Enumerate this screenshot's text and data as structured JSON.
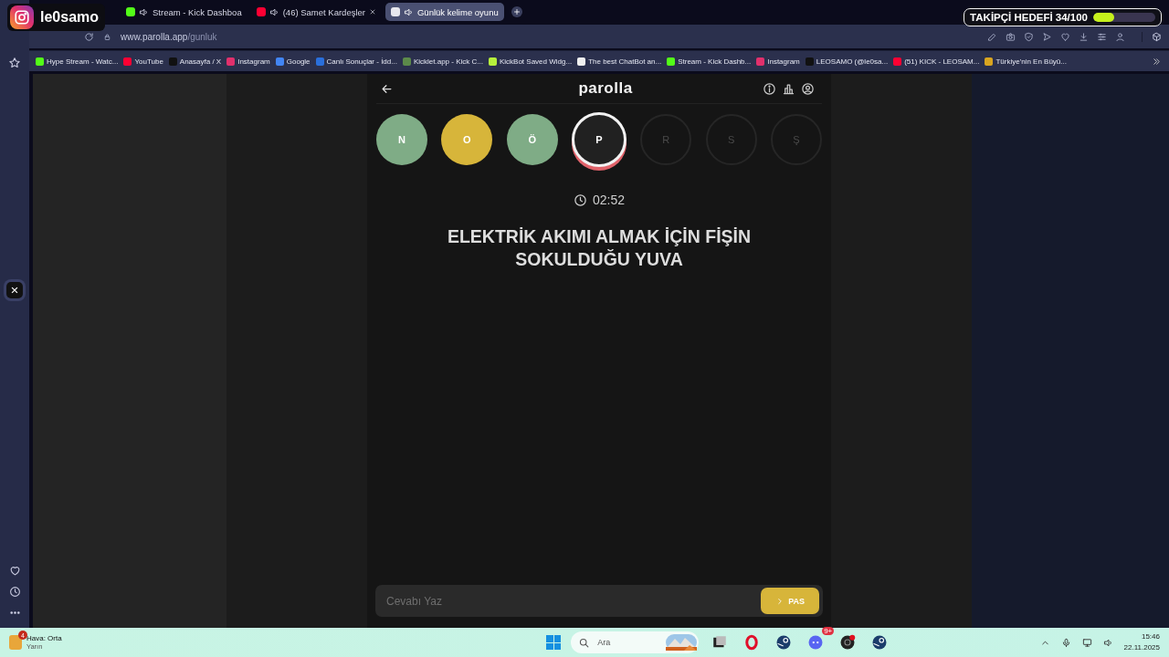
{
  "stream_badge": {
    "username": "le0samo"
  },
  "follower_goal": {
    "label": "TAKİPÇİ HEDEFİ 34/100",
    "level": 0.34
  },
  "tabs": [
    {
      "title": "Stream - Kick Dashboa",
      "audio": true,
      "closable": false,
      "selected": false,
      "color": "#53fc18"
    },
    {
      "title": "(46) Samet Kardeşler",
      "audio": true,
      "closable": true,
      "selected": false,
      "color": "#ff0033"
    },
    {
      "title": "Günlük kelime oyunu",
      "audio": true,
      "closable": false,
      "selected": true,
      "color": "#e8e8ee"
    }
  ],
  "address_bar": {
    "url_host": "www.parolla.app",
    "url_path": "/gunluk"
  },
  "bookmarks": [
    {
      "label": "Hype Stream - Watc...",
      "color": "#53fc18"
    },
    {
      "label": "YouTube",
      "color": "#ff0033"
    },
    {
      "label": "Anasayfa / X",
      "color": "#111111"
    },
    {
      "label": "Instagram",
      "color": "#e1306c"
    },
    {
      "label": "Google",
      "color": "#4285f4"
    },
    {
      "label": "Canlı Sonuçlar - İdd...",
      "color": "#2a6fdb"
    },
    {
      "label": "Kicklet.app - Kick C...",
      "color": "#5c8a4a"
    },
    {
      "label": "KickBot Saved Widg...",
      "color": "#b6f03c"
    },
    {
      "label": "The best ChatBot an...",
      "color": "#f0f0f0"
    },
    {
      "label": "Stream - Kick Dashb...",
      "color": "#53fc18"
    },
    {
      "label": "Instagram",
      "color": "#e1306c"
    },
    {
      "label": "LEOSAMO (@le0sa...",
      "color": "#111111"
    },
    {
      "label": "(51) KICK - LEOSAM...",
      "color": "#ff0033"
    },
    {
      "label": "Türkiye'nin En Büyü...",
      "color": "#d9a520"
    }
  ],
  "game": {
    "title": "parolla",
    "letters": [
      {
        "letter": "N",
        "kind": "correct"
      },
      {
        "letter": "O",
        "kind": "passed"
      },
      {
        "letter": "Ö",
        "kind": "correct"
      },
      {
        "letter": "P",
        "kind": "current"
      },
      {
        "letter": "R",
        "kind": "pending"
      },
      {
        "letter": "S",
        "kind": "pending"
      },
      {
        "letter": "Ş",
        "kind": "pending"
      }
    ],
    "timer": "02:52",
    "question": "ELEKTRİK AKIMI ALMAK İÇİN FİŞİN SOKULDUĞU YUVA",
    "answer": {
      "placeholder": "Cevabı Yaz"
    },
    "pass_button": "PAS"
  },
  "taskbar": {
    "weather": {
      "title": "Hava: Orta",
      "subtitle": "Yarın",
      "badge": "4"
    },
    "search": {
      "placeholder": "Ara"
    },
    "discord_badge": "9+",
    "time": "15:46",
    "date": "22.11.2025"
  }
}
